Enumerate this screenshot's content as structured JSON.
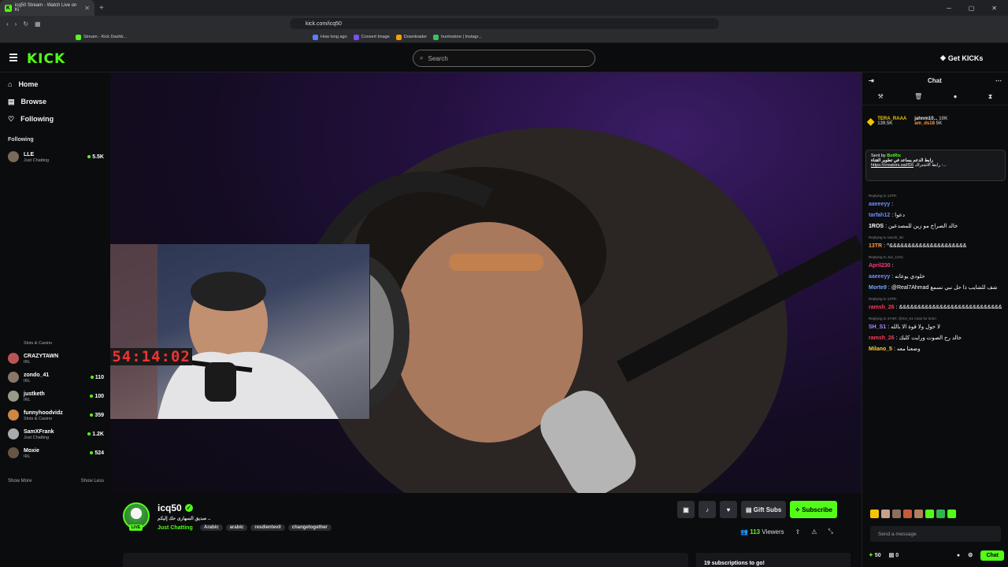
{
  "browser": {
    "tab_title": "icq50 Stream - Watch Live on Ki",
    "url": "kick.com/icq50",
    "bookmarks": [
      "Stream - Kick Dashb...",
      "How long ago",
      "Convert Image",
      "Downloader",
      "huntostore | Instagr..."
    ]
  },
  "topnav": {
    "search_placeholder": "Search",
    "get_kicks": "Get KICKs"
  },
  "sidebar": {
    "nav": [
      {
        "label": "Home"
      },
      {
        "label": "Browse"
      },
      {
        "label": "Following"
      }
    ],
    "following_header": "Following",
    "users": [
      {
        "name": "LLE",
        "category": "Just Chatting",
        "viewers": "5.5K"
      },
      {
        "name": "CRAZYTAWN",
        "category": "IRL",
        "viewers": ""
      },
      {
        "name": "zondo_41",
        "category": "IRL",
        "viewers": "110"
      },
      {
        "name": "justketh",
        "category": "IRL",
        "viewers": "100"
      },
      {
        "name": "funnyhoodvidz",
        "category": "Slots & Casino",
        "viewers": "359"
      },
      {
        "name": "SamXFrank",
        "category": "Just Chatting",
        "viewers": "1.2K"
      },
      {
        "name": "Moxie",
        "category": "IRL",
        "viewers": "524"
      }
    ],
    "partial_category": "Slots & Casino",
    "show_more": "Show More",
    "show_less": "Show Less"
  },
  "video": {
    "timer": "53:54:14:02"
  },
  "stream": {
    "channel": "icq50",
    "live": "LIVE",
    "title": "صديق السهارى حك إليكم ..",
    "category": "Just Chatting",
    "tags": [
      "Arabic",
      "arabic",
      "resdientevil",
      "changetogether"
    ],
    "gift_subs": "Gift Subs",
    "subscribe": "Subscribe",
    "viewers": "113",
    "viewers_label": "Viewers",
    "sub_goal": "19 subscriptions to go!"
  },
  "chat": {
    "title": "Chat",
    "leaders": [
      {
        "name": "TERA_RAAA",
        "amount": "139.5K"
      },
      {
        "name": "jahnm10...",
        "amount": "10K"
      },
      {
        "name": "am_ds18",
        "amount": "5K"
      }
    ],
    "pinned": {
      "sent_by": "Sent by",
      "bot": "BotRix",
      "line1": "رابط الدعم يساعد في تطوير القناة",
      "link": "https://creators.sa/if16",
      "line2": "رابط الاشتراك :..."
    },
    "messages": [
      {
        "reply": "Replying to 13TR:",
        "user": "aaeeeyy",
        "color": "#6f8cff",
        "text": ""
      },
      {
        "reply": "",
        "user": "tarfah12",
        "color": "#6f8cff",
        "text": "دعوا"
      },
      {
        "reply": "",
        "user": "1ROS",
        "color": "#ffffff",
        "text": "خالد الصراخ مو زين للمصدعين"
      },
      {
        "reply": "Replying to ramsh_26:",
        "user": "13TR",
        "color": "#ff9a3c",
        "text": "^&&&&&&&&&&&&&&&&&&&&&"
      },
      {
        "reply": "Replying to Juri_1231:",
        "user": "April230",
        "color": "#ff3b7a",
        "text": ""
      },
      {
        "reply": "",
        "user": "aaeeeyy",
        "color": "#6f8cff",
        "text": "خلودي يوعانه"
      },
      {
        "reply": "",
        "user": "Morte9",
        "color": "#6fa8ff",
        "text": "@Real7Ahmad شف للشايب ذا حل نبي نسمع"
      },
      {
        "reply": "Replying to 13TR:",
        "user": "ramsh_26",
        "color": "#ff3b5c",
        "text": "&&&&&&&&&&&&&&&&&&&&&&&&&&&&"
      },
      {
        "reply": "Replying to 4YSR: @SH_S1 mute for 5min",
        "user": "SH_S1",
        "color": "#b08cff",
        "text": "لا حول ولا قوة الا بالله"
      },
      {
        "reply": "",
        "user": "ramsh_26",
        "color": "#ff3b5c",
        "text": "خالد رح الصوت ورايت كلبك"
      },
      {
        "reply": "",
        "user": "Milano_5",
        "color": "#ffcc33",
        "text": "وضعنا معه"
      }
    ],
    "input_placeholder": "Send a message",
    "points": "50",
    "gifts": "0",
    "chat_button": "Chat"
  }
}
